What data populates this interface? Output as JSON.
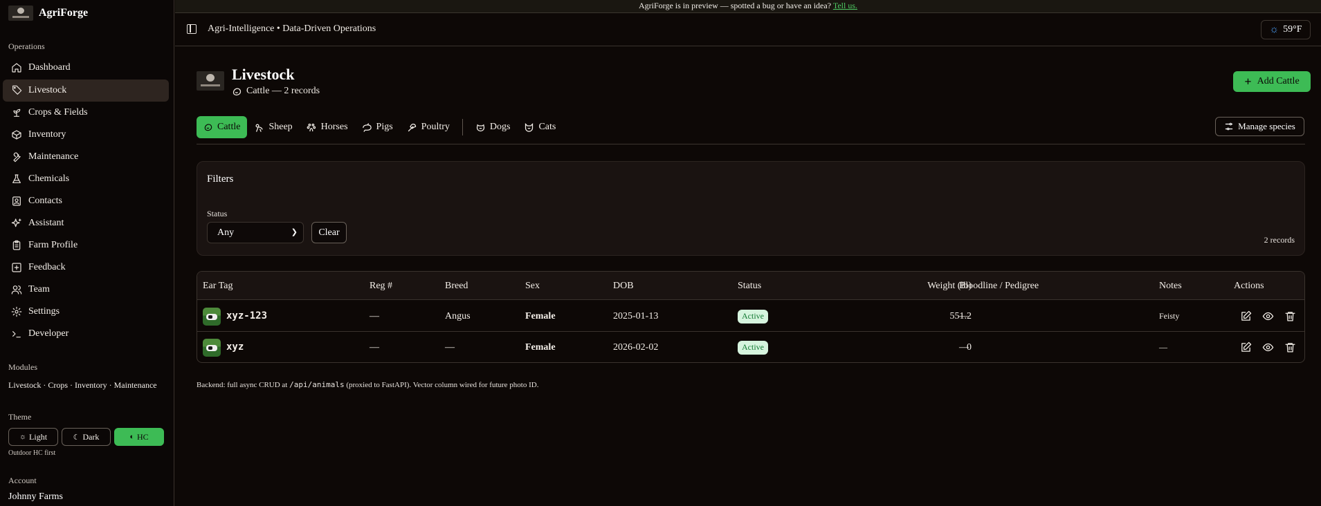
{
  "app": {
    "name": "AgriForge"
  },
  "banner": {
    "text": "AgriForge is in preview — spotted a bug or have an idea?",
    "link": "Tell us."
  },
  "topbar": {
    "breadcrumb": "Agri-Intelligence • Data-Driven Operations",
    "weather": "59°F"
  },
  "sidebar": {
    "operations_label": "Operations",
    "items": [
      {
        "label": "Dashboard",
        "icon": "home-icon"
      },
      {
        "label": "Livestock",
        "icon": "tag-icon"
      },
      {
        "label": "Crops & Fields",
        "icon": "sprout-icon"
      },
      {
        "label": "Inventory",
        "icon": "box-icon"
      },
      {
        "label": "Maintenance",
        "icon": "wrench-icon"
      },
      {
        "label": "Chemicals",
        "icon": "flask-icon"
      },
      {
        "label": "Contacts",
        "icon": "contact-icon"
      },
      {
        "label": "Assistant",
        "icon": "sparkles-icon"
      },
      {
        "label": "Farm Profile",
        "icon": "clipboard-icon"
      },
      {
        "label": "Feedback",
        "icon": "message-plus-icon"
      },
      {
        "label": "Team",
        "icon": "users-icon"
      },
      {
        "label": "Settings",
        "icon": "gear-icon"
      },
      {
        "label": "Developer",
        "icon": "terminal-icon"
      }
    ],
    "modules_label": "Modules",
    "modules_text": "Livestock · Crops · Inventory · Maintenance",
    "theme_label": "Theme",
    "theme": {
      "light": "Light",
      "dark": "Dark",
      "hc": "HC"
    },
    "theme_note": "Outdoor HC first",
    "account_label": "Account",
    "account_name": "Johnny Farms"
  },
  "page": {
    "title": "Livestock",
    "subtitle": "Cattle — 2 records",
    "add_button": "Add Cattle",
    "manage_species": "Manage species",
    "tabs": [
      {
        "label": "Cattle",
        "icon": "cattle-icon"
      },
      {
        "label": "Sheep",
        "icon": "sheep-icon"
      },
      {
        "label": "Horses",
        "icon": "horse-icon"
      },
      {
        "label": "Pigs",
        "icon": "pig-icon"
      },
      {
        "label": "Poultry",
        "icon": "poultry-icon"
      },
      {
        "label": "Dogs",
        "icon": "dog-icon"
      },
      {
        "label": "Cats",
        "icon": "cat-icon"
      }
    ]
  },
  "filters": {
    "title": "Filters",
    "status_label": "Status",
    "status_value": "Any",
    "clear": "Clear",
    "count": "2 records"
  },
  "table": {
    "columns": [
      "Ear Tag",
      "Reg #",
      "Breed",
      "Sex",
      "DOB",
      "Status",
      "Weight (lb)",
      "Bloodline / Pedigree",
      "Notes",
      "Actions"
    ],
    "rows": [
      {
        "ear_tag": "xyz-123",
        "reg": "—",
        "breed": "Angus",
        "sex": "Female",
        "dob": "2025-01-13",
        "status": "Active",
        "weight": "551.2",
        "bloodline": "—",
        "notes": "Feisty"
      },
      {
        "ear_tag": "xyz",
        "reg": "—",
        "breed": "—",
        "sex": "Female",
        "dob": "2026-02-02",
        "status": "Active",
        "weight": "0",
        "bloodline": "—",
        "notes": "—"
      }
    ]
  },
  "footnote": {
    "pre": "Backend: full async CRUD at",
    "code": "/api/animals",
    "post": "(proxied to FastAPI). Vector column wired for future photo ID."
  },
  "colors": {
    "accent": "#3dbb55",
    "background": "#0d0806",
    "badge_bg": "#d6f4de",
    "badge_fg": "#137a33"
  }
}
